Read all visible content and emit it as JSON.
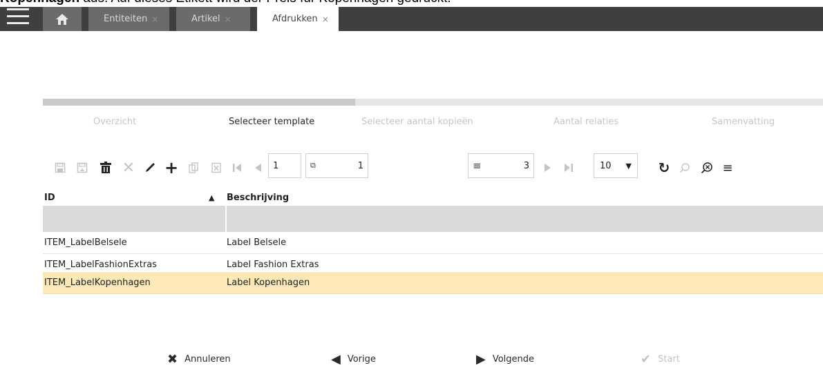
{
  "caption": {
    "bold": "Kopenhagen",
    "rest": " aus. Auf dieses Etikett wird der Preis für Kopenhagen gedruckt."
  },
  "topbar": {
    "tabs": [
      {
        "label": "Entiteiten",
        "close": "×"
      },
      {
        "label": "Artikel",
        "close": "×"
      },
      {
        "label": "Afdrukken",
        "close": "×"
      }
    ]
  },
  "wizard": {
    "progress_fraction": 0.4,
    "steps": [
      {
        "label": "Overzicht"
      },
      {
        "label": "Selecteer template"
      },
      {
        "label": "Selecteer aantal kopieën"
      },
      {
        "label": "Aantal relaties"
      },
      {
        "label": "Samenvatting"
      }
    ],
    "active_step": 1
  },
  "pager": {
    "page": "1",
    "pages": "1",
    "records": "3",
    "page_size": "10"
  },
  "grid": {
    "columns": [
      "ID",
      "Beschrijving"
    ],
    "sort_indicator": "▲",
    "rows": [
      {
        "id": "ITEM_LabelBelsele",
        "desc": "Label Belsele"
      },
      {
        "id": "ITEM_LabelFashionExtras",
        "desc": "Label Fashion Extras"
      },
      {
        "id": "ITEM_LabelKopenhagen",
        "desc": "Label Kopenhagen"
      }
    ],
    "selected_row": 2
  },
  "footer": {
    "cancel": "Annuleren",
    "prev": "Vorige",
    "next": "Volgende",
    "start": "Start"
  },
  "colors": {
    "topbar": "#3f3f3f",
    "tab_inactive": "#6b6b6b",
    "selected_row": "#fde9b7",
    "filter_row": "#dadada"
  }
}
